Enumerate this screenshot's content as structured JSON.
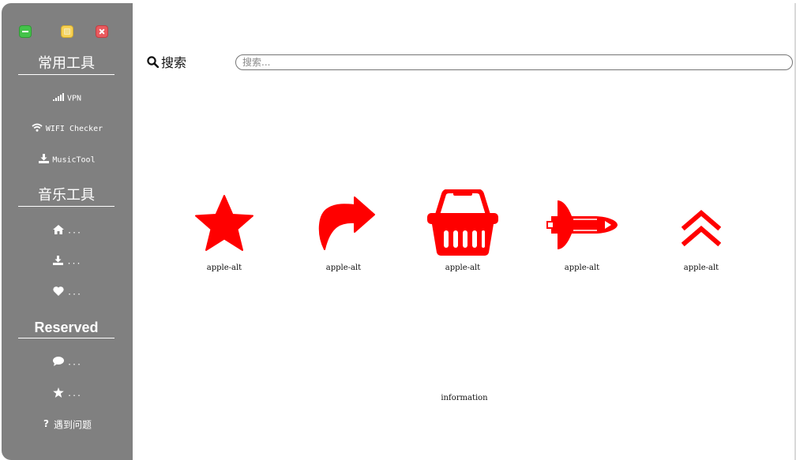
{
  "window": {
    "controls": [
      "minimize",
      "maximize",
      "close"
    ]
  },
  "sidebar": {
    "sections": [
      {
        "title": "常用工具",
        "items": [
          {
            "label": "VPN",
            "icon": "signal-bars-icon"
          },
          {
            "label": "WIFI Checker",
            "icon": "wifi-icon"
          },
          {
            "label": "MusicTool",
            "icon": "download-icon"
          }
        ]
      },
      {
        "title": "音乐工具",
        "items": [
          {
            "label": "...",
            "icon": "home-icon"
          },
          {
            "label": "...",
            "icon": "download-icon"
          },
          {
            "label": "...",
            "icon": "heart-icon"
          }
        ]
      },
      {
        "title": "Reserved",
        "items": [
          {
            "label": "...",
            "icon": "comment-icon"
          },
          {
            "label": "...",
            "icon": "star-icon"
          }
        ]
      }
    ],
    "help": {
      "label": "遇到问题",
      "icon": "question-icon"
    }
  },
  "main": {
    "search": {
      "label": "搜索",
      "icon": "search-icon",
      "placeholder": "搜索...",
      "value": ""
    },
    "icon_grid": [
      {
        "icon": "star-icon",
        "caption": "apple-alt"
      },
      {
        "icon": "share-arrow-icon",
        "caption": "apple-alt"
      },
      {
        "icon": "shopping-basket-icon",
        "caption": "apple-alt"
      },
      {
        "icon": "space-shuttle-icon",
        "caption": "apple-alt"
      },
      {
        "icon": "double-chevron-up-icon",
        "caption": "apple-alt"
      }
    ],
    "footer_text": "information"
  },
  "colors": {
    "sidebar_bg": "#808080",
    "icon_red": "#ff0000",
    "text_white": "#ffffff"
  }
}
